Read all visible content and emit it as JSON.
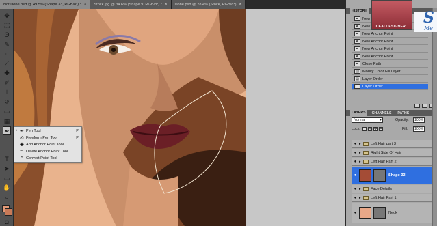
{
  "tabs": [
    {
      "label": "Not Done.psd @ 49.5% (Shape 33, RGB/8*) *",
      "active": true
    },
    {
      "label": "Stock.jpg @ 34.6% (Shape 9, RGB/8*) *",
      "active": false
    },
    {
      "label": "Done.psd @ 28.4% (Stock, RGB/8*)",
      "active": false
    }
  ],
  "tab_close": "×",
  "flyout": {
    "items": [
      {
        "label": "Pen Tool",
        "key": "P",
        "icon": "pen-icon",
        "selected": true
      },
      {
        "label": "Freeform Pen Tool",
        "key": "P",
        "icon": "freeform-pen-icon"
      },
      {
        "label": "Add Anchor Point Tool",
        "key": "",
        "icon": "add-anchor-icon"
      },
      {
        "label": "Delete Anchor Point Tool",
        "key": "",
        "icon": "delete-anchor-icon"
      },
      {
        "label": "Convert Point Tool",
        "key": "",
        "icon": "convert-point-icon"
      }
    ]
  },
  "history": {
    "tab": "HISTORY",
    "rows": [
      {
        "label": "New Anchor Point",
        "selected": false
      },
      {
        "label": "New Anchor Point",
        "selected": false
      },
      {
        "label": "New Anchor Point",
        "selected": false
      },
      {
        "label": "New Anchor Point",
        "selected": false
      },
      {
        "label": "New Anchor Point",
        "selected": false
      },
      {
        "label": "New Anchor Point",
        "selected": false
      },
      {
        "label": "Close Path",
        "selected": false
      },
      {
        "label": "Modify Color Fill Layer",
        "selected": false
      },
      {
        "label": "Layer Order",
        "selected": false
      },
      {
        "label": "Layer Order",
        "selected": true
      }
    ]
  },
  "layers_panel": {
    "tabs": [
      "LAYERS",
      "CHANNELS",
      "PATHS"
    ],
    "blend_mode": "Normal",
    "opacity_label": "Opacity:",
    "opacity_value": "100%",
    "lock_label": "Lock:",
    "fill_label": "Fill:",
    "fill_value": "100%",
    "layers": [
      {
        "name": "Left Hair part 3",
        "kind": "group",
        "selected": false
      },
      {
        "name": "Right Side Of Hair",
        "kind": "group",
        "selected": false
      },
      {
        "name": "Left Hair Part 2",
        "kind": "group",
        "selected": false
      },
      {
        "name": "Shape 33",
        "kind": "shape",
        "selected": true
      },
      {
        "name": "Face Details",
        "kind": "group",
        "selected": false
      },
      {
        "name": "Left Hair Part 1",
        "kind": "group",
        "selected": false
      },
      {
        "name": "Neck",
        "kind": "shape",
        "selected": false
      }
    ]
  },
  "watermark": {
    "logo_text": "IDEALDESIGNER",
    "brand_letter": "S",
    "brand_sub": "Me"
  },
  "colors": {
    "selection": "#2f6fe0",
    "skin": "#e8b08a",
    "hair": "#7a4a2c",
    "lips": "#6b1f26"
  }
}
